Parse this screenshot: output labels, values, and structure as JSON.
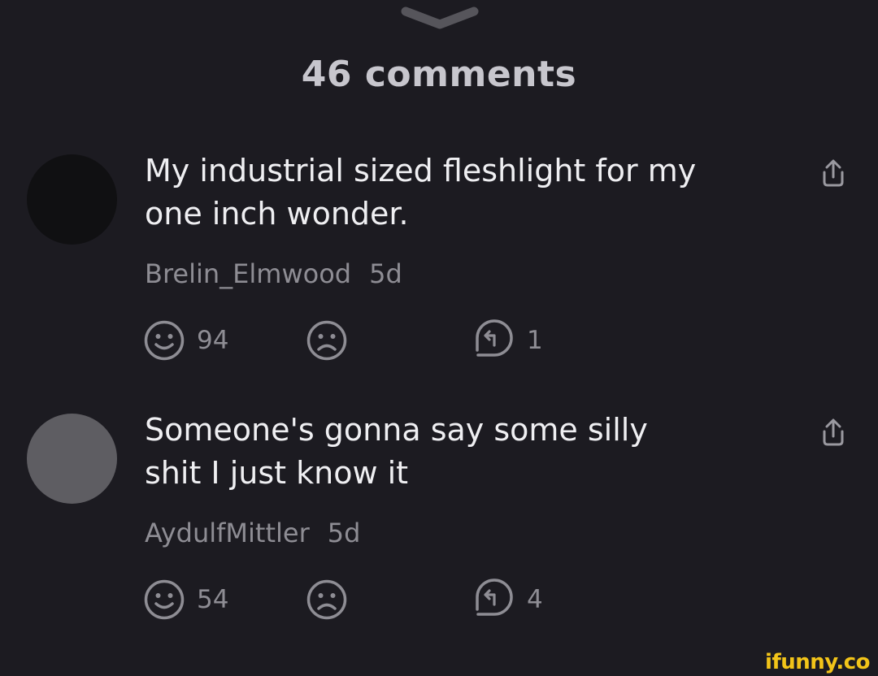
{
  "header": {
    "collapse_icon": "chevron-down-icon",
    "title": "46 comments"
  },
  "comments": [
    {
      "avatar_color": "#101012",
      "text_line1": "My industrial sized fleshlight for my",
      "text_line2": "one inch wonder.",
      "author": "Brelin_Elmwood",
      "age": "5d",
      "likes": "94",
      "replies": "1",
      "icons": [
        "share-icon",
        "smile-icon",
        "frown-icon",
        "reply-icon"
      ]
    },
    {
      "avatar_color": "#5e5d62",
      "text_line1": "Someone's gonna say some silly",
      "text_line2": "shit I just know it",
      "author": "AydulfMittler",
      "age": "5d",
      "likes": "54",
      "replies": "4",
      "icons": [
        "share-icon",
        "smile-icon",
        "frown-icon",
        "reply-icon"
      ]
    }
  ],
  "watermark": "ifunny.co",
  "colors": {
    "background": "#1c1b21",
    "text": "#efeff2",
    "muted": "#8e8d94",
    "watermark": "#f2c419"
  }
}
